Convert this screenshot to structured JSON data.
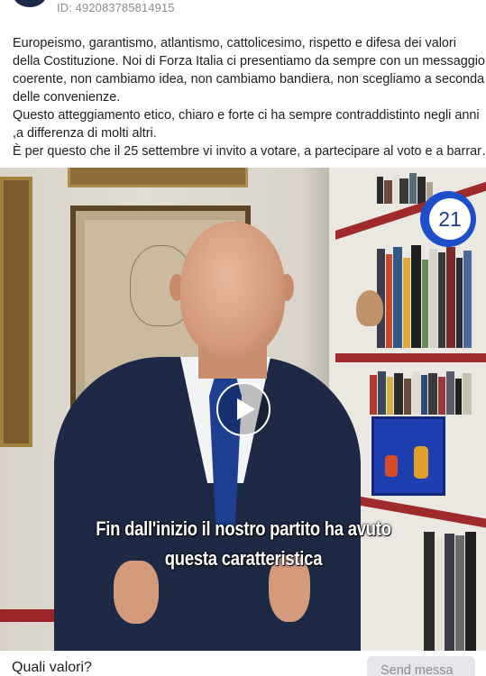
{
  "header": {
    "ad_id": "ID: 492083785814915"
  },
  "post": {
    "lines": [
      "Europeismo, garantismo, atlantismo, cattolicesimo, rispetto e difesa dei valori",
      "della Costituzione. Noi di Forza Italia ci presentiamo da sempre con un messaggio",
      "coerente, non cambiamo idea, non cambiamo bandiera, non scegliamo a seconda",
      "delle convenienze.",
      "Questo atteggiamento etico, chiaro e forte ci ha sempre contraddistinto negli anni",
      ",a differenza di molti altri.",
      "È per questo che il 25 settembre vi invito a votare, a partecipare al voto e a barrar…"
    ]
  },
  "video": {
    "badge_number": "21",
    "caption_lines": [
      "Fin dall'inizio il nostro partito ha avuto",
      "questa caratteristica"
    ]
  },
  "footer": {
    "title": "Quali valori?",
    "send_button": "Send messa"
  },
  "colors": {
    "accent_blue": "#1c4fc9",
    "shelf_red": "#9e2a2b",
    "text": "#1c1e21",
    "muted": "#8a8d91"
  }
}
